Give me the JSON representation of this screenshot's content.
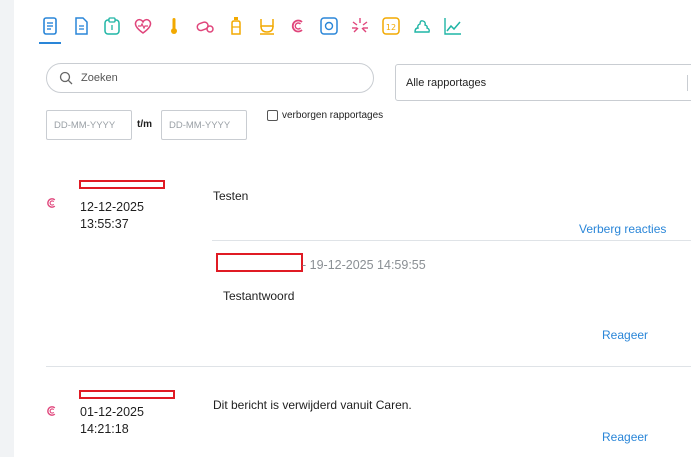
{
  "search": {
    "placeholder": "Zoeken"
  },
  "filter": {
    "selected": "Alle rapportages"
  },
  "dates": {
    "from_placeholder": "DD-MM-YYYY",
    "to_label": "t/m",
    "to_placeholder": "DD-MM-YYYY"
  },
  "hidden_toggle": {
    "label": "verborgen rapportages"
  },
  "tabs": [
    {
      "icon": "report-icon",
      "color": "#2a86d8"
    },
    {
      "icon": "document-icon",
      "color": "#2a86d8"
    },
    {
      "icon": "clipboard-icon",
      "color": "#1fb5a5"
    },
    {
      "icon": "heartbeat-icon",
      "color": "#e0457b"
    },
    {
      "icon": "thermometer-icon",
      "color": "#f2a900"
    },
    {
      "icon": "capsule-icon",
      "color": "#e0457b"
    },
    {
      "icon": "bottle-icon",
      "color": "#f2a900"
    },
    {
      "icon": "toilet-icon",
      "color": "#f2a900"
    },
    {
      "icon": "caren-icon",
      "color": "#e0457b"
    },
    {
      "icon": "scale-icon",
      "color": "#2a86d8"
    },
    {
      "icon": "pain-icon",
      "color": "#e0457b"
    },
    {
      "icon": "score-icon",
      "color": "#f2a900"
    },
    {
      "icon": "stool-icon",
      "color": "#1fb5a5"
    },
    {
      "icon": "chart-icon",
      "color": "#1fb5a5"
    }
  ],
  "posts": [
    {
      "date": "12-12-2025",
      "time": "13:55:37",
      "message": "Testen",
      "toggle_label": "Verberg reacties",
      "reply": {
        "meta": "- 19-12-2025 14:59:55",
        "text": "Testantwoord",
        "action_label": "Reageer"
      }
    },
    {
      "date": "01-12-2025",
      "time": "14:21:18",
      "message": "Dit bericht is verwijderd vanuit Caren.",
      "action_label": "Reageer"
    }
  ],
  "colors": {
    "accent": "#2a86d8",
    "caren_pink": "#e0457b",
    "redaction": "#e01b24"
  }
}
